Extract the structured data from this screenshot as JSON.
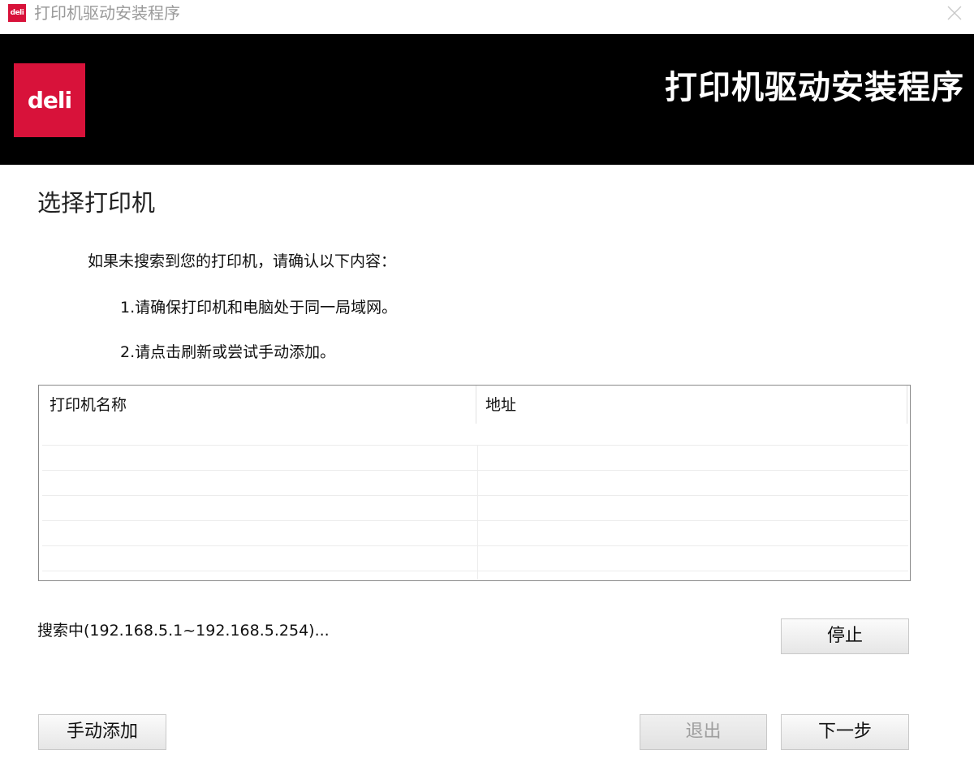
{
  "window": {
    "title": "打印机驱动安装程序",
    "app_icon_text": "deli"
  },
  "banner": {
    "logo_text": "deli",
    "title": "打印机驱动安装程序"
  },
  "section_title": "选择打印机",
  "instructions": {
    "intro": "如果未搜索到您的打印机，请确认以下内容：",
    "items": [
      "1.请确保打印机和电脑处于同一局域网。",
      "2.请点击刷新或尝试手动添加。"
    ]
  },
  "printer_table": {
    "columns": [
      "打印机名称",
      "地址"
    ],
    "rows": []
  },
  "search_status": "搜索中(192.168.5.1~192.168.5.254)...",
  "buttons": {
    "stop": "停止",
    "manual_add": "手动添加",
    "exit": "退出",
    "next": "下一步"
  },
  "colors": {
    "brand_red": "#d8123a",
    "banner_bg": "#000000"
  }
}
